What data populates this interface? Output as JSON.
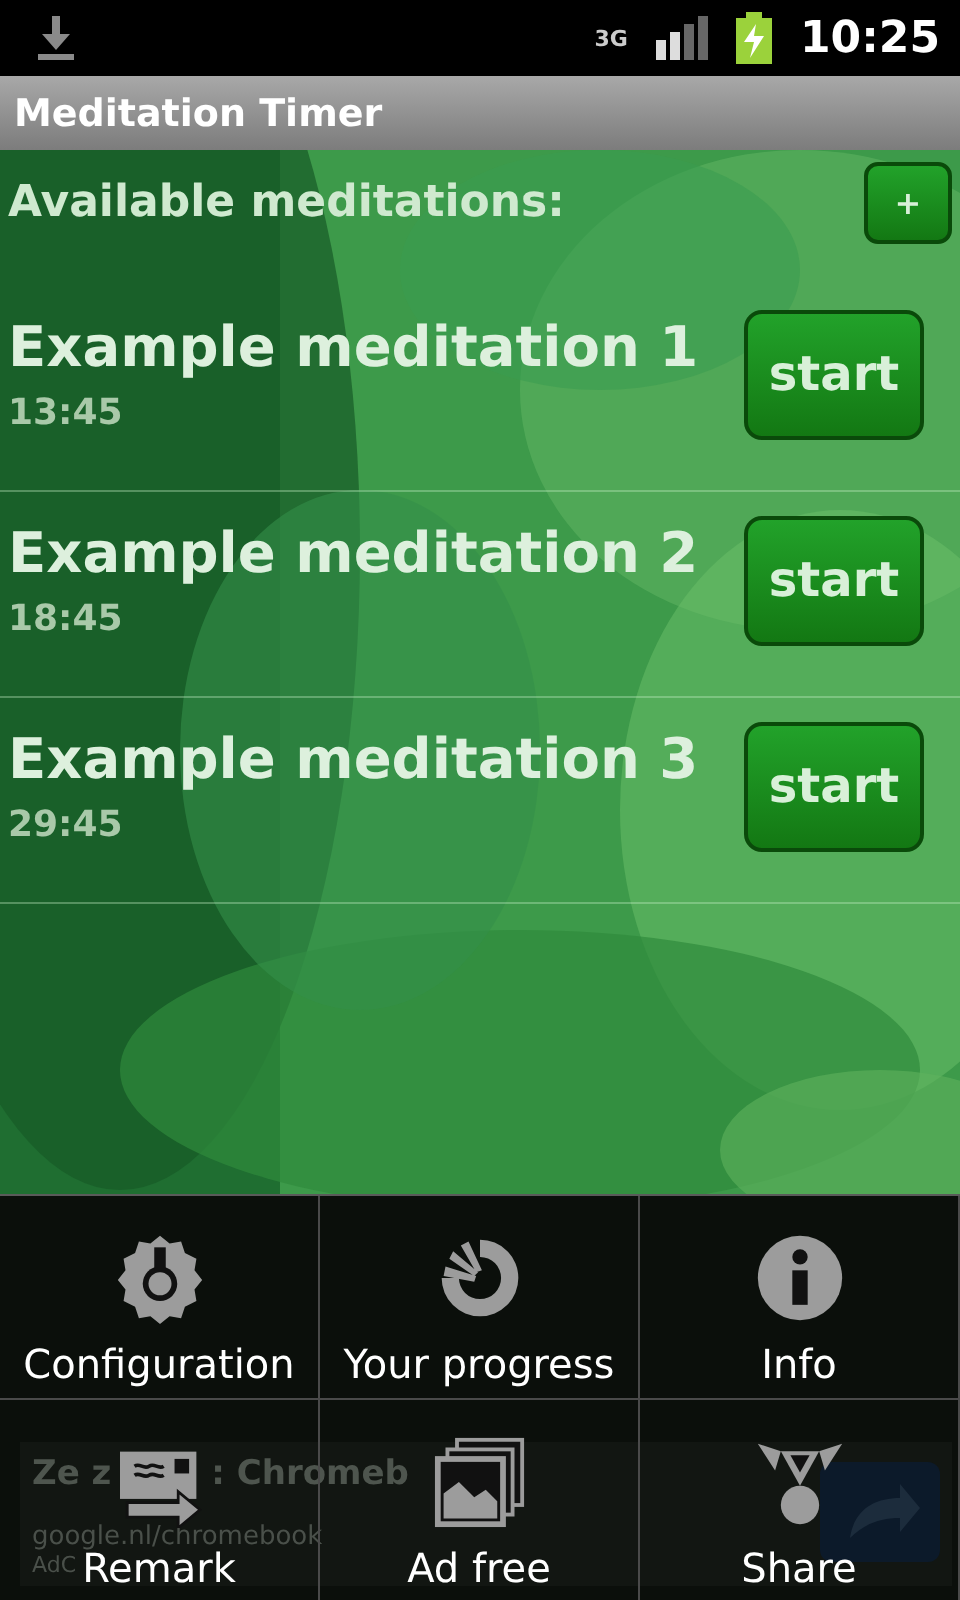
{
  "status_bar": {
    "time": "10:25",
    "network": "3G"
  },
  "window": {
    "title": "Meditation Timer"
  },
  "header": {
    "title": "Available meditations:",
    "add_button": "+"
  },
  "meditations": [
    {
      "name": "Example meditation 1",
      "duration": "13:45",
      "button": "start"
    },
    {
      "name": "Example meditation 2",
      "duration": "18:45",
      "button": "start"
    },
    {
      "name": "Example meditation 3",
      "duration": "29:45",
      "button": "start"
    }
  ],
  "ad": {
    "headline_start": "Ze z",
    "headline_end": ": Chromeb",
    "url": "google.nl/chromebook",
    "attribution": "AdC"
  },
  "menu": [
    {
      "label": "Configuration",
      "kind": "config"
    },
    {
      "label": "Your progress",
      "kind": "progress"
    },
    {
      "label": "Info",
      "kind": "info"
    },
    {
      "label": "Remark",
      "kind": "remark"
    },
    {
      "label": "Ad free",
      "kind": "adfree"
    },
    {
      "label": "Share",
      "kind": "share"
    }
  ]
}
